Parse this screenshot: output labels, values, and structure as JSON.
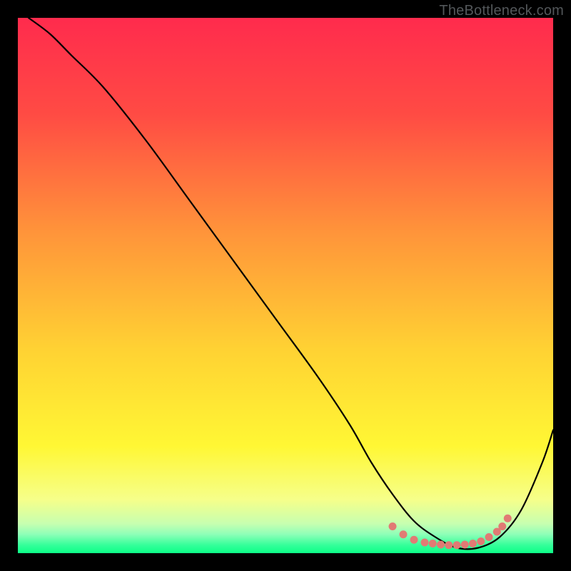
{
  "attribution": "TheBottleneck.com",
  "chart_data": {
    "type": "line",
    "title": "",
    "xlabel": "",
    "ylabel": "",
    "xlim": [
      0,
      100
    ],
    "ylim": [
      0,
      100
    ],
    "background_gradient": {
      "stops": [
        {
          "offset": 0.0,
          "color": "#ff2b4d"
        },
        {
          "offset": 0.18,
          "color": "#ff4b44"
        },
        {
          "offset": 0.4,
          "color": "#ff943a"
        },
        {
          "offset": 0.62,
          "color": "#ffd233"
        },
        {
          "offset": 0.8,
          "color": "#fff734"
        },
        {
          "offset": 0.9,
          "color": "#f6ff8a"
        },
        {
          "offset": 0.945,
          "color": "#c7ffb0"
        },
        {
          "offset": 0.965,
          "color": "#8dffb8"
        },
        {
          "offset": 0.985,
          "color": "#34ff9a"
        },
        {
          "offset": 1.0,
          "color": "#0cff87"
        }
      ]
    },
    "series": [
      {
        "name": "bottleneck-curve",
        "color": "#000000",
        "x": [
          2,
          6,
          10,
          16,
          24,
          32,
          40,
          48,
          56,
          62,
          66,
          70,
          74,
          78,
          82,
          86,
          90,
          94,
          98,
          100
        ],
        "y": [
          100,
          97,
          93,
          87,
          77,
          66,
          55,
          44,
          33,
          24,
          17,
          11,
          6,
          3,
          1,
          1,
          3,
          8,
          17,
          23
        ]
      }
    ],
    "marker_cluster": {
      "name": "optimal-range-markers",
      "color": "#e17a74",
      "points": [
        {
          "x": 70,
          "y": 5
        },
        {
          "x": 72,
          "y": 3.5
        },
        {
          "x": 74,
          "y": 2.5
        },
        {
          "x": 76,
          "y": 2
        },
        {
          "x": 77.5,
          "y": 1.8
        },
        {
          "x": 79,
          "y": 1.6
        },
        {
          "x": 80.5,
          "y": 1.5
        },
        {
          "x": 82,
          "y": 1.5
        },
        {
          "x": 83.5,
          "y": 1.6
        },
        {
          "x": 85,
          "y": 1.8
        },
        {
          "x": 86.5,
          "y": 2.2
        },
        {
          "x": 88,
          "y": 3
        },
        {
          "x": 89.5,
          "y": 4
        },
        {
          "x": 90.5,
          "y": 5
        },
        {
          "x": 91.5,
          "y": 6.5
        }
      ]
    }
  }
}
